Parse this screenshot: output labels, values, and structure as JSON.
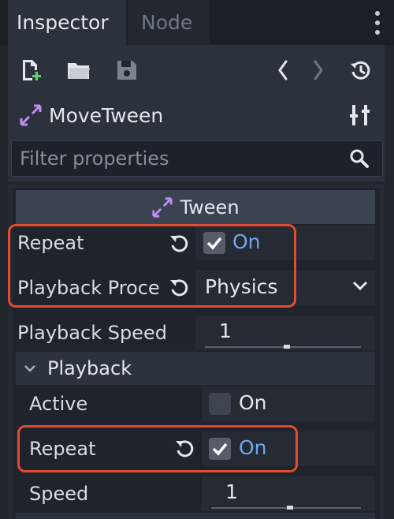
{
  "tabs": [
    {
      "label": "Inspector",
      "active": true
    },
    {
      "label": "Node",
      "active": false
    }
  ],
  "toolbar": {
    "icons": [
      "new-resource-icon",
      "open-folder-icon",
      "save-icon",
      "history-back-icon",
      "history-forward-icon",
      "object-history-icon"
    ]
  },
  "node": {
    "name": "MoveTween",
    "icon": "tween-icon",
    "tools_icon": "tools-icon"
  },
  "filter": {
    "placeholder": "Filter properties"
  },
  "section": {
    "title": "Tween"
  },
  "properties": {
    "repeat": {
      "label": "Repeat",
      "value": "On",
      "checked": true
    },
    "playback_process": {
      "label": "Playback Proce",
      "value": "Physics"
    },
    "playback_speed": {
      "label": "Playback Speed",
      "value": "1"
    }
  },
  "playback": {
    "title": "Playback",
    "active": {
      "label": "Active",
      "value": "On",
      "checked": false
    },
    "repeat": {
      "label": "Repeat",
      "value": "On",
      "checked": true
    },
    "speed": {
      "label": "Speed",
      "value": "1"
    }
  },
  "colors": {
    "accent_purple": "#c08df2",
    "on_blue": "#6ea8ec",
    "highlight_red": "#e34a32"
  }
}
